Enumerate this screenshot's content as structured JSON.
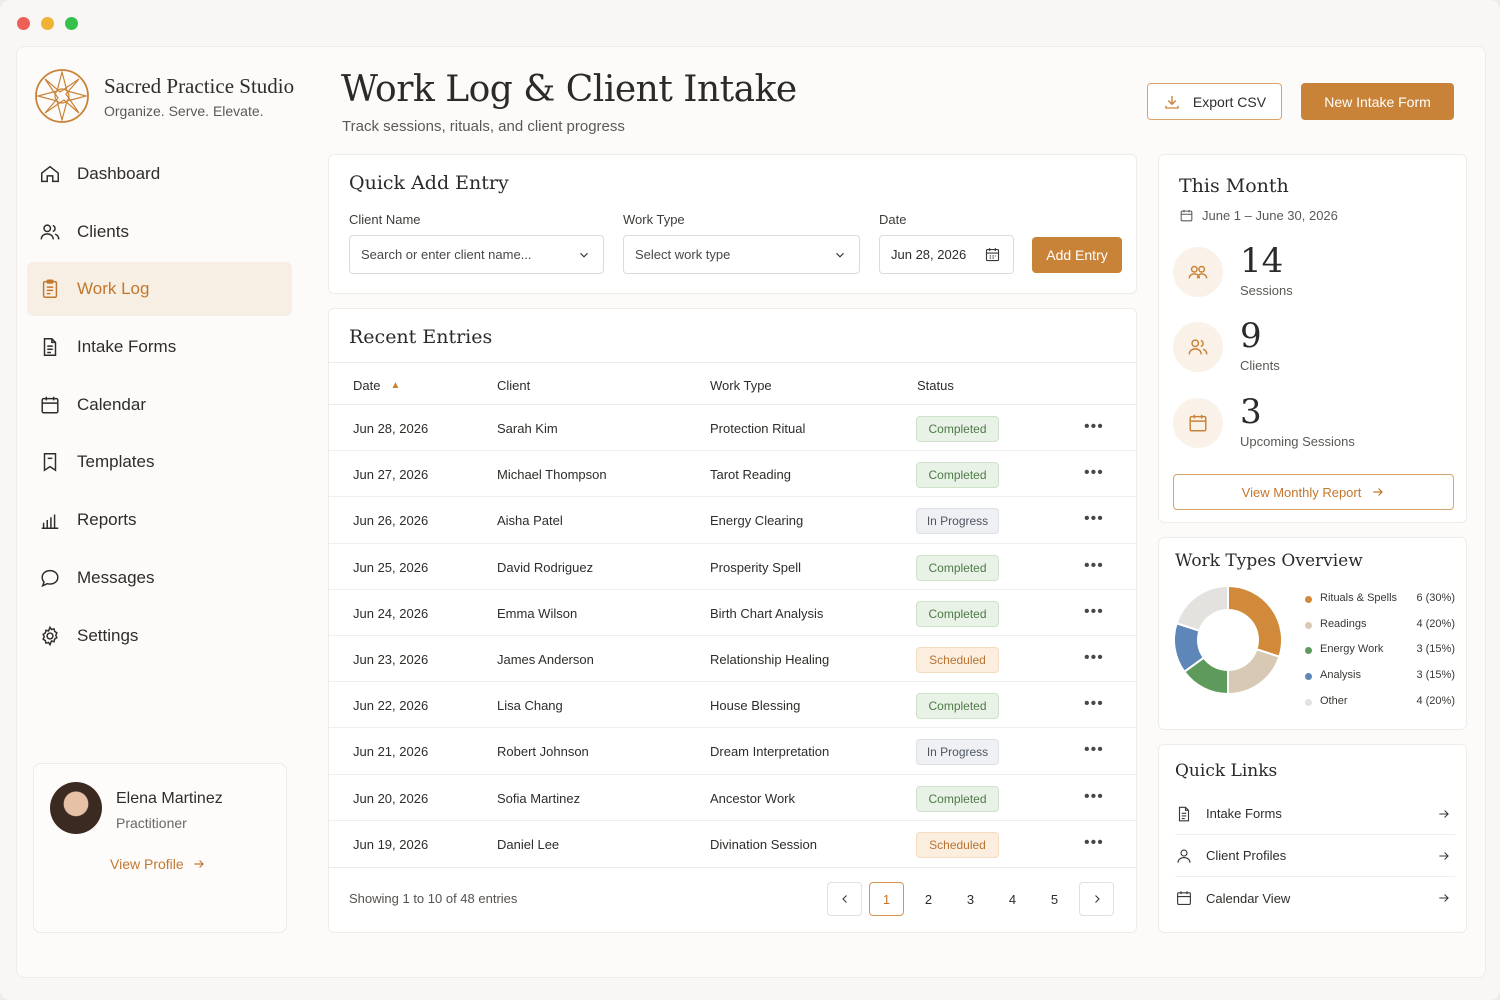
{
  "brand": {
    "name": "Sacred Practice Studio",
    "tagline": "Organize. Serve. Elevate."
  },
  "colors": {
    "accent": "#c98338",
    "completed": "#4f7a48",
    "in_progress": "#4d5562",
    "scheduled": "#b87433"
  },
  "nav": [
    {
      "label": "Dashboard",
      "icon": "home-icon"
    },
    {
      "label": "Clients",
      "icon": "users-icon"
    },
    {
      "label": "Work Log",
      "icon": "clipboard-icon",
      "active": true
    },
    {
      "label": "Intake Forms",
      "icon": "document-icon"
    },
    {
      "label": "Calendar",
      "icon": "calendar-icon"
    },
    {
      "label": "Templates",
      "icon": "bookmark-icon"
    },
    {
      "label": "Reports",
      "icon": "bar-chart-icon"
    },
    {
      "label": "Messages",
      "icon": "chat-icon"
    },
    {
      "label": "Settings",
      "icon": "gear-icon"
    }
  ],
  "profile": {
    "name": "Elena Martinez",
    "role": "Practitioner",
    "link": "View Profile"
  },
  "header": {
    "title": "Work Log & Client Intake",
    "subtitle": "Track sessions, rituals, and client progress",
    "export_label": "Export CSV",
    "new_label": "New Intake Form"
  },
  "quick_add": {
    "title": "Quick Add Entry",
    "client_label": "Client Name",
    "client_placeholder": "Search or enter client name...",
    "type_label": "Work Type",
    "type_placeholder": "Select work type",
    "date_label": "Date",
    "date_value": "Jun 28, 2026",
    "button": "Add Entry"
  },
  "recent": {
    "title": "Recent Entries",
    "columns": [
      "Date",
      "Client",
      "Work Type",
      "Status"
    ],
    "rows": [
      {
        "date": "Jun 28, 2026",
        "client": "Sarah Kim",
        "type": "Protection Ritual",
        "status": "Completed"
      },
      {
        "date": "Jun 27, 2026",
        "client": "Michael Thompson",
        "type": "Tarot Reading",
        "status": "Completed"
      },
      {
        "date": "Jun 26, 2026",
        "client": "Aisha Patel",
        "type": "Energy Clearing",
        "status": "In Progress"
      },
      {
        "date": "Jun 25, 2026",
        "client": "David Rodriguez",
        "type": "Prosperity Spell",
        "status": "Completed"
      },
      {
        "date": "Jun 24, 2026",
        "client": "Emma Wilson",
        "type": "Birth Chart Analysis",
        "status": "Completed"
      },
      {
        "date": "Jun 23, 2026",
        "client": "James Anderson",
        "type": "Relationship Healing",
        "status": "Scheduled"
      },
      {
        "date": "Jun 22, 2026",
        "client": "Lisa Chang",
        "type": "House Blessing",
        "status": "Completed"
      },
      {
        "date": "Jun 21, 2026",
        "client": "Robert Johnson",
        "type": "Dream Interpretation",
        "status": "In Progress"
      },
      {
        "date": "Jun 20, 2026",
        "client": "Sofia Martinez",
        "type": "Ancestor Work",
        "status": "Completed"
      },
      {
        "date": "Jun 19, 2026",
        "client": "Daniel Lee",
        "type": "Divination Session",
        "status": "Scheduled"
      }
    ],
    "footer": "Showing 1 to 10 of 48 entries",
    "pages": [
      "1",
      "2",
      "3",
      "4",
      "5"
    ],
    "current_page": "1"
  },
  "this_month": {
    "title": "This Month",
    "range": "June 1 – June 30, 2026",
    "stats": [
      {
        "value": "14",
        "label": "Sessions",
        "icon": "people-icon"
      },
      {
        "value": "9",
        "label": "Clients",
        "icon": "users-icon"
      },
      {
        "value": "3",
        "label": "Upcoming Sessions",
        "icon": "calendar-icon"
      }
    ],
    "button": "View Monthly Report"
  },
  "work_types": {
    "title": "Work Types Overview",
    "items": [
      {
        "name": "Rituals & Spells",
        "value": 6,
        "display": "6 (30%)",
        "color": "#d08a3a"
      },
      {
        "name": "Readings",
        "value": 4,
        "display": "4 (20%)",
        "color": "#d8c9b4"
      },
      {
        "name": "Energy Work",
        "value": 3,
        "display": "3 (15%)",
        "color": "#5e9a5c"
      },
      {
        "name": "Analysis",
        "value": 3,
        "display": "3 (15%)",
        "color": "#5e86b8"
      },
      {
        "name": "Other",
        "value": 4,
        "display": "4 (20%)",
        "color": "#e4e2df"
      }
    ]
  },
  "quick_links": {
    "title": "Quick Links",
    "items": [
      {
        "label": "Intake Forms",
        "icon": "document-icon"
      },
      {
        "label": "Client Profiles",
        "icon": "user-icon"
      },
      {
        "label": "Calendar View",
        "icon": "calendar-icon"
      }
    ]
  }
}
